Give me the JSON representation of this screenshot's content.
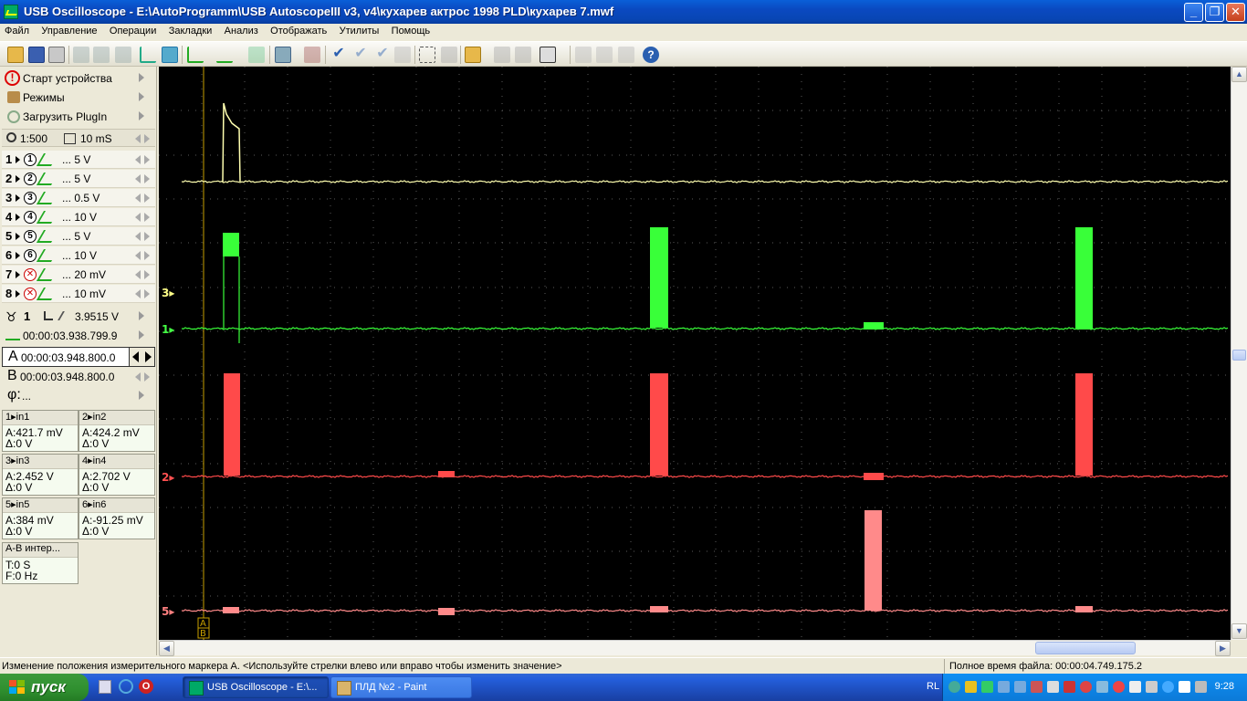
{
  "window": {
    "title": "USB Oscilloscope - E:\\AutoProgramm\\USB AutoscopeIII v3, v4\\кухарев актрос 1998 PLD\\кухарев 7.mwf",
    "minimize": "_",
    "maximize": "❐",
    "close": "✕"
  },
  "menu": [
    "Файл",
    "Управление",
    "Операции",
    "Закладки",
    "Анализ",
    "Отображать",
    "Утилиты",
    "Помощь"
  ],
  "left": {
    "start_device": "Старт устройства",
    "modes": "Режимы",
    "load_plugin": "Загрузить PlugIn",
    "zoom": "1:500",
    "timebase": "10 mS",
    "channels": [
      {
        "num": "1",
        "circ": "1",
        "value": "... 5 V",
        "on": true
      },
      {
        "num": "2",
        "circ": "2",
        "value": "... 5 V",
        "on": true
      },
      {
        "num": "3",
        "circ": "3",
        "value": "... 0.5 V",
        "on": true
      },
      {
        "num": "4",
        "circ": "4",
        "value": "... 10 V",
        "on": true
      },
      {
        "num": "5",
        "circ": "5",
        "value": "... 5 V",
        "on": true
      },
      {
        "num": "6",
        "circ": "6",
        "value": "... 10 V",
        "on": true
      },
      {
        "num": "7",
        "circ": "✕",
        "value": "... 20 mV",
        "on": false
      },
      {
        "num": "8",
        "circ": "✕",
        "value": "... 10 mV",
        "on": false
      }
    ],
    "trigger_channel": "1",
    "trigger_level": "3.9515 V",
    "trigger_time": "00:00:03.938.799.9",
    "marker_a_label": "A",
    "marker_a": "00:00:03.948.800.0",
    "marker_b_label": "B",
    "marker_b": "00:00:03.948.800.0",
    "phi_label": "φ:",
    "phi_value": "...",
    "measures": [
      {
        "head": "1▸in1",
        "a": "A:421.7 mV",
        "d": "Δ:0 V"
      },
      {
        "head": "2▸in2",
        "a": "A:424.2 mV",
        "d": "Δ:0 V"
      },
      {
        "head": "3▸in3",
        "a": "A:2.452 V",
        "d": "Δ:0 V"
      },
      {
        "head": "4▸in4",
        "a": "A:2.702 V",
        "d": "Δ:0 V"
      },
      {
        "head": "5▸in5",
        "a": "A:384 mV",
        "d": "Δ:0 V"
      },
      {
        "head": "6▸in6",
        "a": "A:-91.25 mV",
        "d": "Δ:0 V"
      }
    ],
    "interval": {
      "head": "A-B интер...",
      "t": "T:0 S",
      "f": "F:0 Hz"
    }
  },
  "scope": {
    "labels": [
      {
        "text": "3▸",
        "color": "#ffff88"
      },
      {
        "text": "1▸",
        "color": "#44ff44"
      },
      {
        "text": "2▸",
        "color": "#ff5050"
      },
      {
        "text": "5▸",
        "color": "#ff8080"
      }
    ],
    "marker_a": "A",
    "marker_b": "B",
    "colors": {
      "ch3": "#ffffb0",
      "ch1": "#39ff39",
      "ch2": "#ff4a4a",
      "ch5": "#ff8a8a",
      "grid": "#5a5a5a",
      "marker": "#c8a000"
    }
  },
  "status": {
    "hint": "Изменение положения измерительного маркера A.  <Используйте стрелки влево или вправо чтобы изменить значение>",
    "file_time": "Полное время файла: 00:00:04.749.175.2"
  },
  "taskbar": {
    "start": "пуск",
    "tasks": [
      "USB Oscilloscope - E:\\...",
      "ПЛД №2 - Paint"
    ],
    "lang": "RL",
    "clock": "9:28"
  }
}
